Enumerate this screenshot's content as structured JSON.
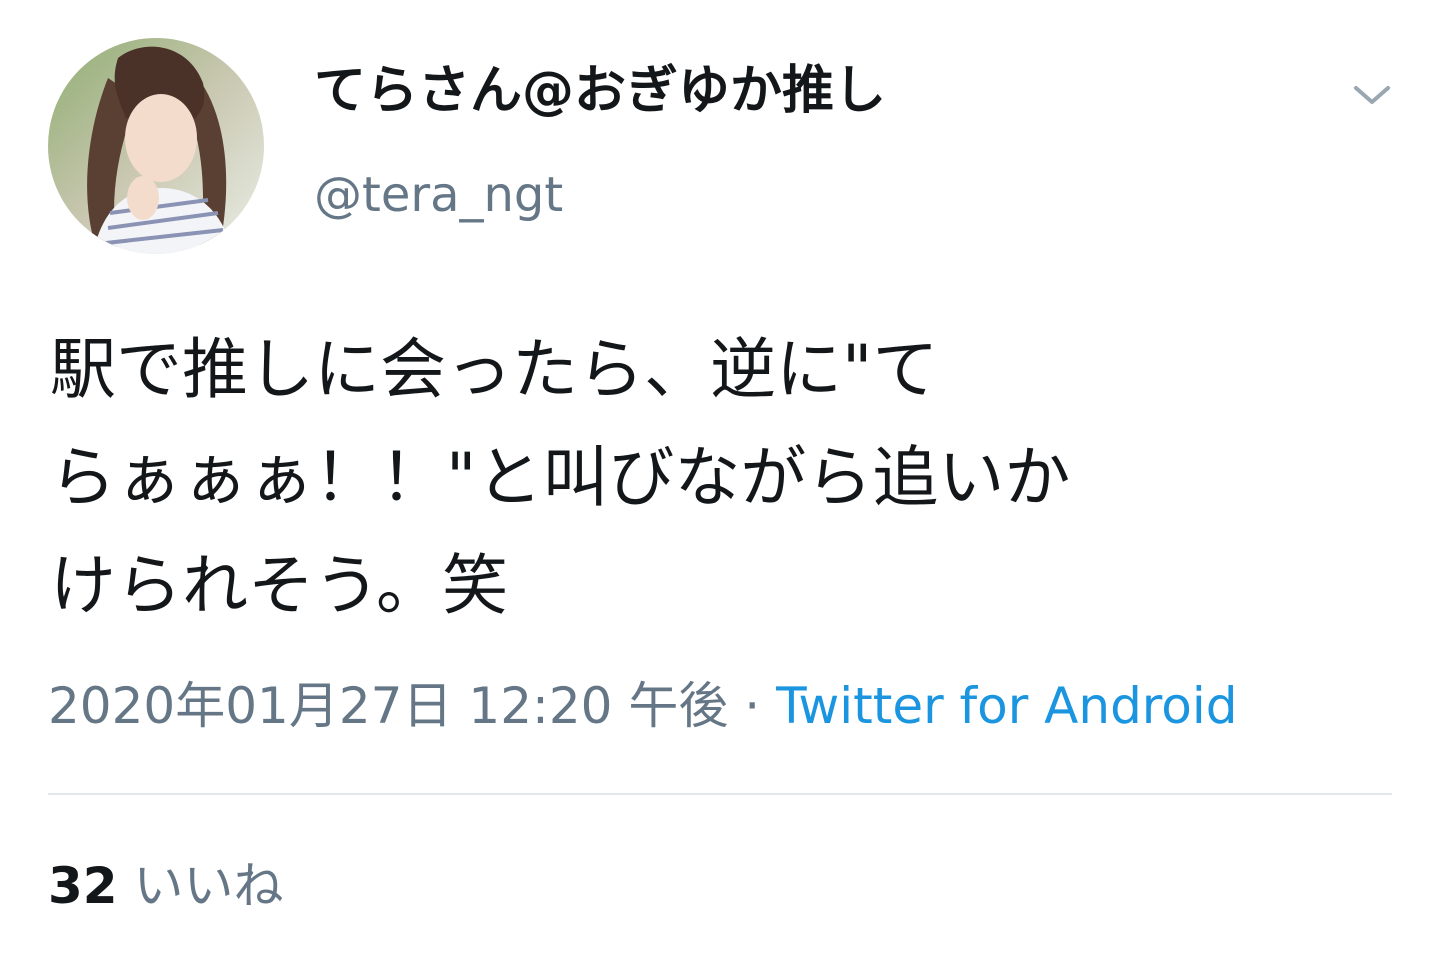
{
  "author": {
    "display_name": "てらさん@おぎゆか推し",
    "handle": "@tera_ngt"
  },
  "tweet": {
    "text_lines": [
      "駅で推しに会ったら、逆に\"て",
      "らぁぁぁ！！\"と叫びながら追いか",
      "けられそう。笑"
    ],
    "timestamp": "2020年01月27日 12:20 午後",
    "separator": " · ",
    "source": "Twitter for Android"
  },
  "stats": {
    "likes_count": "32",
    "likes_label": "いいね"
  },
  "icons": {
    "menu": "chevron-down-icon",
    "avatar": "avatar"
  },
  "colors": {
    "text_primary": "#14171a",
    "text_secondary": "#657786",
    "link": "#1b95e0",
    "divider": "#e1e8ed"
  }
}
